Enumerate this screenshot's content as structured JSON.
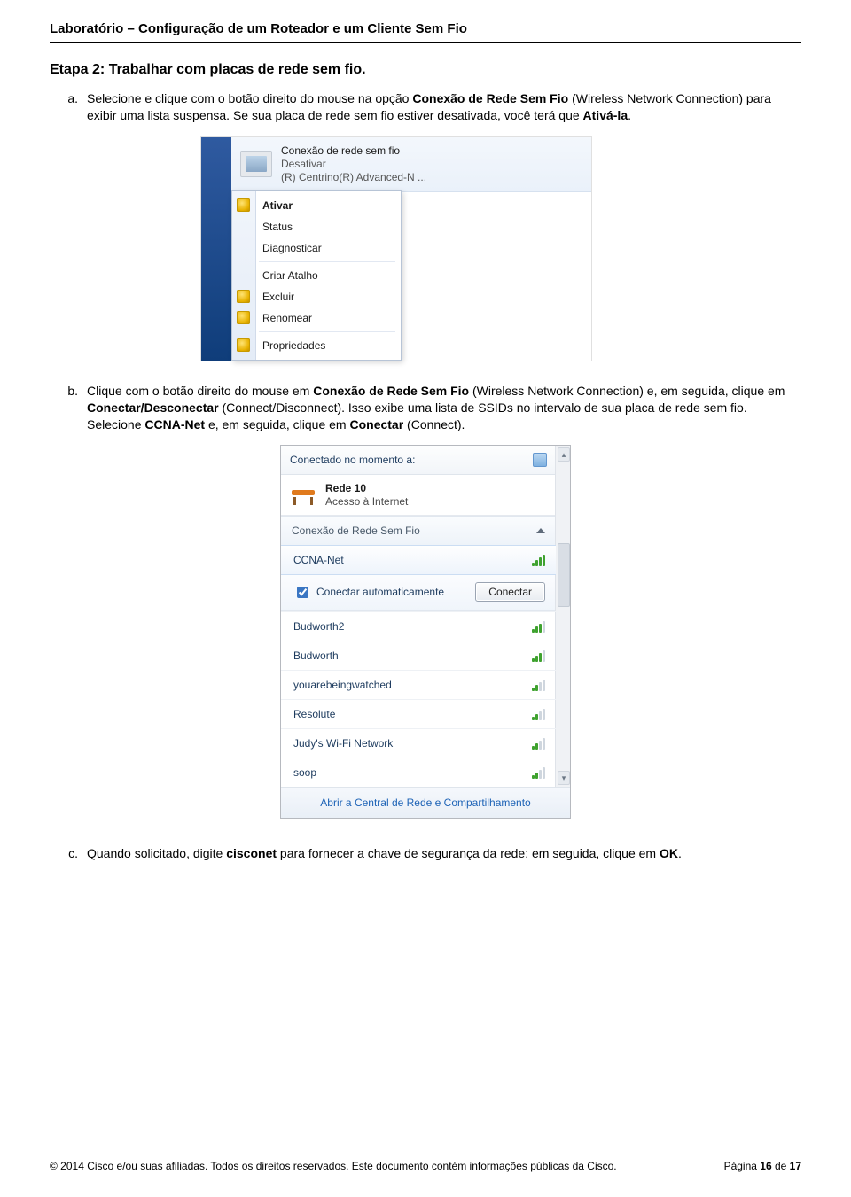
{
  "doc": {
    "title": "Laboratório – Configuração de um Roteador e um Cliente Sem Fio",
    "step_title": "Etapa 2:  Trabalhar com placas de rede sem fio."
  },
  "paragraphs": {
    "a_label": "a.",
    "a_p1_1": "Selecione e clique com o botão direito do mouse na opção ",
    "a_p1_b1": "Conexão de Rede Sem Fio",
    "a_p1_2": " (Wireless Network Connection) para exibir uma lista suspensa. Se sua placa de rede sem fio estiver desativada, você terá que ",
    "a_p1_b2": "Ativá-la",
    "a_p1_3": ".",
    "b_label": "b.",
    "b_p1_1": "Clique com o botão direito do mouse em ",
    "b_p1_b1": "Conexão de Rede Sem Fio",
    "b_p1_2": " (Wireless Network Connection) e, em seguida, clique em ",
    "b_p1_b2": "Conectar/Desconectar",
    "b_p1_3": " (Connect/Disconnect). Isso exibe uma lista de SSIDs no intervalo de sua placa de rede sem fio. Selecione ",
    "b_p1_b3": "CCNA-Net",
    "b_p1_4": " e, em seguida, clique em ",
    "b_p1_b4": "Conectar",
    "b_p1_5": " (Connect).",
    "c_label": "c.",
    "c_p1_1": "Quando solicitado, digite ",
    "c_p1_b1": "cisconet",
    "c_p1_2": " para fornecer a chave de segurança da rede; em seguida, clique em ",
    "c_p1_b2": "OK",
    "c_p1_3": "."
  },
  "fig1": {
    "adapter_name": "Conexão de rede sem fio",
    "adapter_status": "Desativar",
    "adapter_desc": "(R) Centrino(R) Advanced-N ...",
    "menu": {
      "activate": "Ativar",
      "status": "Status",
      "diagnose": "Diagnosticar",
      "shortcut": "Criar Atalho",
      "delete": "Excluir",
      "rename": "Renomear",
      "properties": "Propriedades"
    }
  },
  "fig2": {
    "header": "Conectado no momento a:",
    "current_name": "Rede 10",
    "current_sub": "Acesso à Internet",
    "section": "Conexão de Rede Sem Fio",
    "auto_label": "Conectar automaticamente",
    "connect_btn": "Conectar",
    "footer_link": "Abrir a Central de Rede e Compartilhamento",
    "nets": {
      "n0": "CCNA-Net",
      "n1": "Budworth2",
      "n2": "Budworth",
      "n3": "youarebeingwatched",
      "n4": "Resolute",
      "n5": "Judy's Wi-Fi Network",
      "n6": "soop"
    }
  },
  "footer": {
    "left": "© 2014 Cisco e/ou suas afiliadas. Todos os direitos reservados. Este documento contém informações públicas da Cisco.",
    "right_1": "Página ",
    "right_2": "16",
    "right_3": " de ",
    "right_4": "17"
  }
}
